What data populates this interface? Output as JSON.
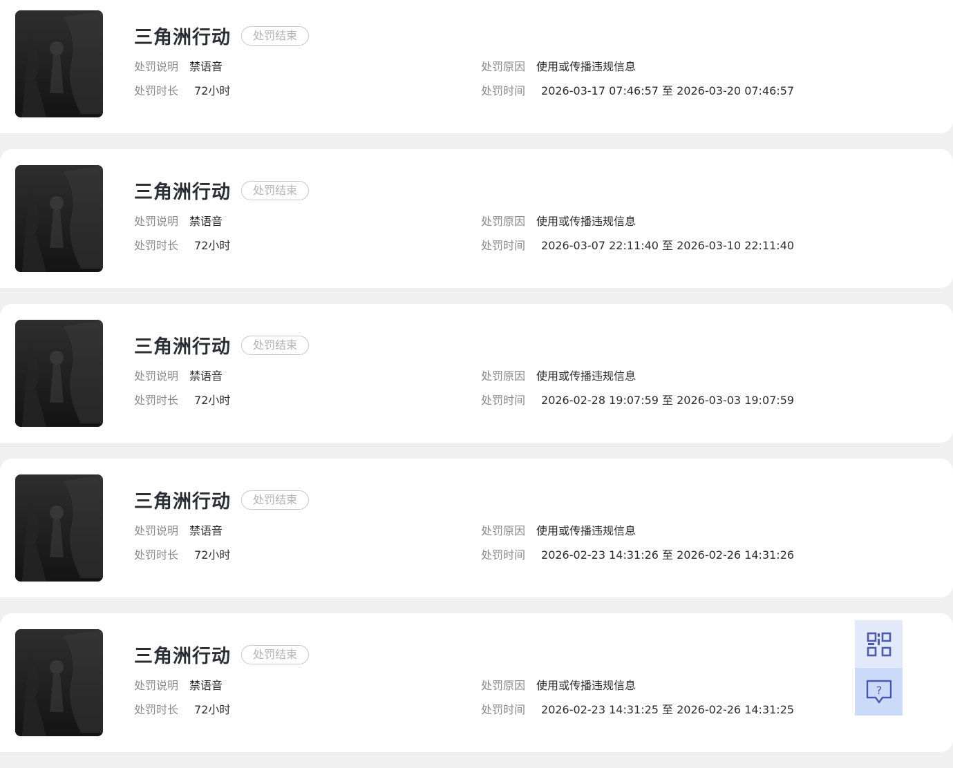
{
  "records": [
    {
      "game": "三角洲行动",
      "status": "处罚结束",
      "desc_label": "处罚说明",
      "desc_value": "禁语音",
      "reason_label": "处罚原因",
      "reason_value": "使用或传播违规信息",
      "duration_label": "处罚时长",
      "duration_value": "72小时",
      "time_label": "处罚时间",
      "time_value": "2026-03-17 07:46:57 至 2026-03-20 07:46:57"
    },
    {
      "game": "三角洲行动",
      "status": "处罚结束",
      "desc_label": "处罚说明",
      "desc_value": "禁语音",
      "reason_label": "处罚原因",
      "reason_value": "使用或传播违规信息",
      "duration_label": "处罚时长",
      "duration_value": "72小时",
      "time_label": "处罚时间",
      "time_value": "2026-03-07 22:11:40 至 2026-03-10 22:11:40"
    },
    {
      "game": "三角洲行动",
      "status": "处罚结束",
      "desc_label": "处罚说明",
      "desc_value": "禁语音",
      "reason_label": "处罚原因",
      "reason_value": "使用或传播违规信息",
      "duration_label": "处罚时长",
      "duration_value": "72小时",
      "time_label": "处罚时间",
      "time_value": "2026-02-28 19:07:59 至 2026-03-03 19:07:59"
    },
    {
      "game": "三角洲行动",
      "status": "处罚结束",
      "desc_label": "处罚说明",
      "desc_value": "禁语音",
      "reason_label": "处罚原因",
      "reason_value": "使用或传播违规信息",
      "duration_label": "处罚时长",
      "duration_value": "72小时",
      "time_label": "处罚时间",
      "time_value": "2026-02-23 14:31:26 至 2026-02-26 14:31:26"
    },
    {
      "game": "三角洲行动",
      "status": "处罚结束",
      "desc_label": "处罚说明",
      "desc_value": "禁语音",
      "reason_label": "处罚原因",
      "reason_value": "使用或传播违规信息",
      "duration_label": "处罚时长",
      "duration_value": "72小时",
      "time_label": "处罚时间",
      "time_value": "2026-02-23 14:31:25 至 2026-02-26 14:31:25"
    }
  ],
  "float_tools": {
    "qr_icon": "qr-code-icon",
    "help_icon": "help-chat-icon",
    "accent": "#4a5aa8"
  }
}
